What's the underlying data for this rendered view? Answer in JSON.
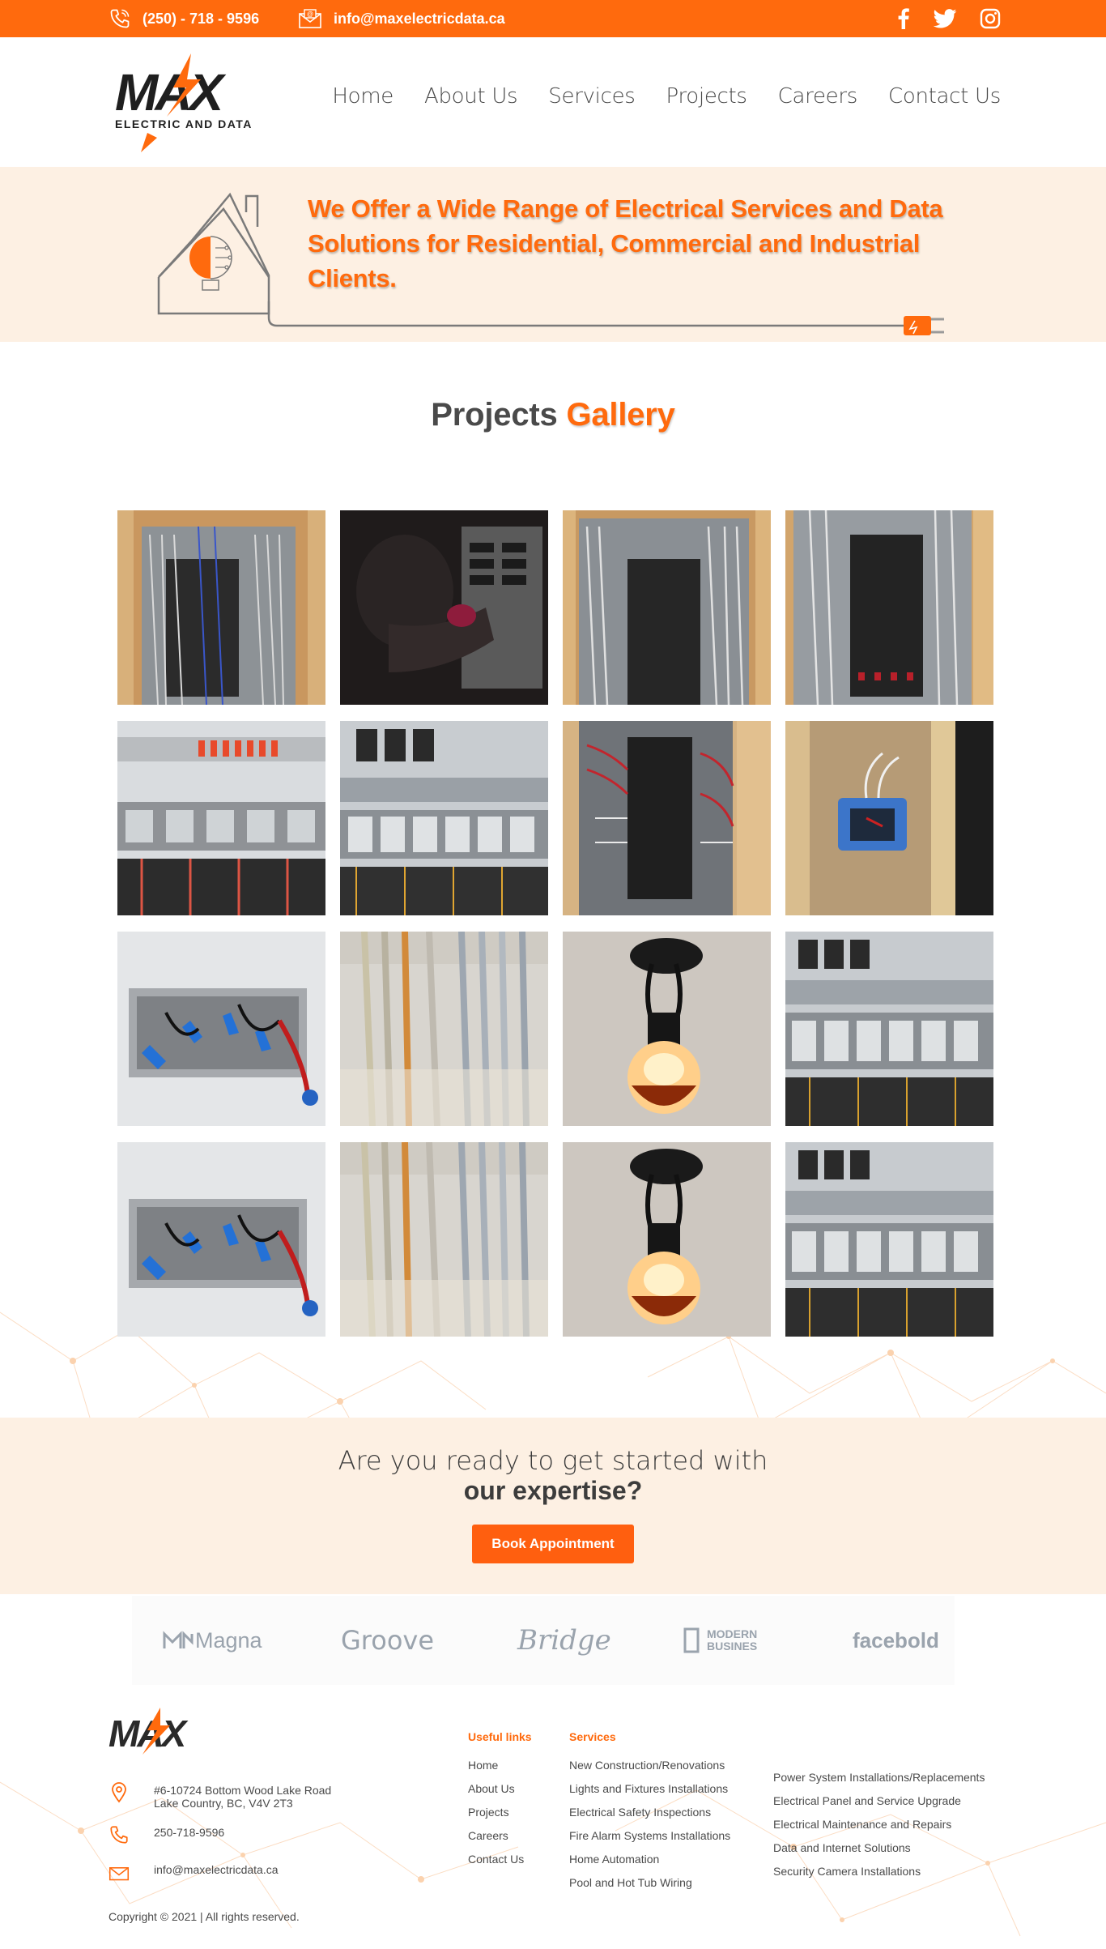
{
  "topbar": {
    "phone": "(250) - 718 - 9596",
    "email": "info@maxelectricdata.ca",
    "social": [
      "facebook-icon",
      "twitter-icon",
      "instagram-icon"
    ]
  },
  "brand": {
    "name": "MAX",
    "tagline": "Electric and Data",
    "accent_color": "#ff6a0d"
  },
  "nav": {
    "items": [
      "Home",
      "About Us",
      "Services",
      "Projects",
      "Careers",
      "Contact Us"
    ]
  },
  "hero": {
    "headline": "We Offer a Wide Range of Electrical Services and Data Solutions for Residential, Commercial and Industrial Clients."
  },
  "gallery": {
    "title_part1": "Projects",
    "title_part2": "Gallery",
    "images": [
      "panel-wiring-1",
      "technician-working",
      "panel-wiring-2",
      "panel-wiring-3",
      "control-cabinet-1",
      "control-cabinet-2",
      "breaker-panel-red",
      "junction-box-blue",
      "outlet-box-wiring",
      "conduit-cables",
      "lit-bulb",
      "control-cabinet-3",
      "outlet-box-wiring",
      "conduit-cables",
      "lit-bulb",
      "control-cabinet-3"
    ]
  },
  "cta": {
    "line1": "Are you ready to get started with",
    "line2": "our expertise?",
    "button": "Book Appointment"
  },
  "partners": {
    "magna": "Magna",
    "groove": "Groove",
    "bridge": "Bridge",
    "modern_line1": "MODERN",
    "modern_line2": "BUSINES",
    "facebold": "facebold"
  },
  "footer": {
    "address_line1": "#6-10724 Bottom Wood Lake Road",
    "address_line2": "Lake Country, BC, V4V 2T3",
    "phone": "250-718-9596",
    "email": "info@maxelectricdata.ca",
    "copyright": "Copyright © 2021  |  All rights reserved.",
    "useful_links_title": "Useful links",
    "useful_links": [
      "Home",
      "About Us",
      "Projects",
      "Careers",
      "Contact Us"
    ],
    "services_title": "Services",
    "services_col1": [
      "New Construction/Renovations",
      "Lights and Fixtures Installations",
      "Electrical Safety Inspections",
      "Fire Alarm Systems Installations",
      "Home Automation",
      "Pool and Hot Tub Wiring"
    ],
    "services_col2": [
      "Power System Installations/Replacements",
      "Electrical Panel and Service Upgrade",
      "Electrical Maintenance and Repairs",
      "Data and Internet Solutions",
      "Security Camera Installations"
    ]
  }
}
